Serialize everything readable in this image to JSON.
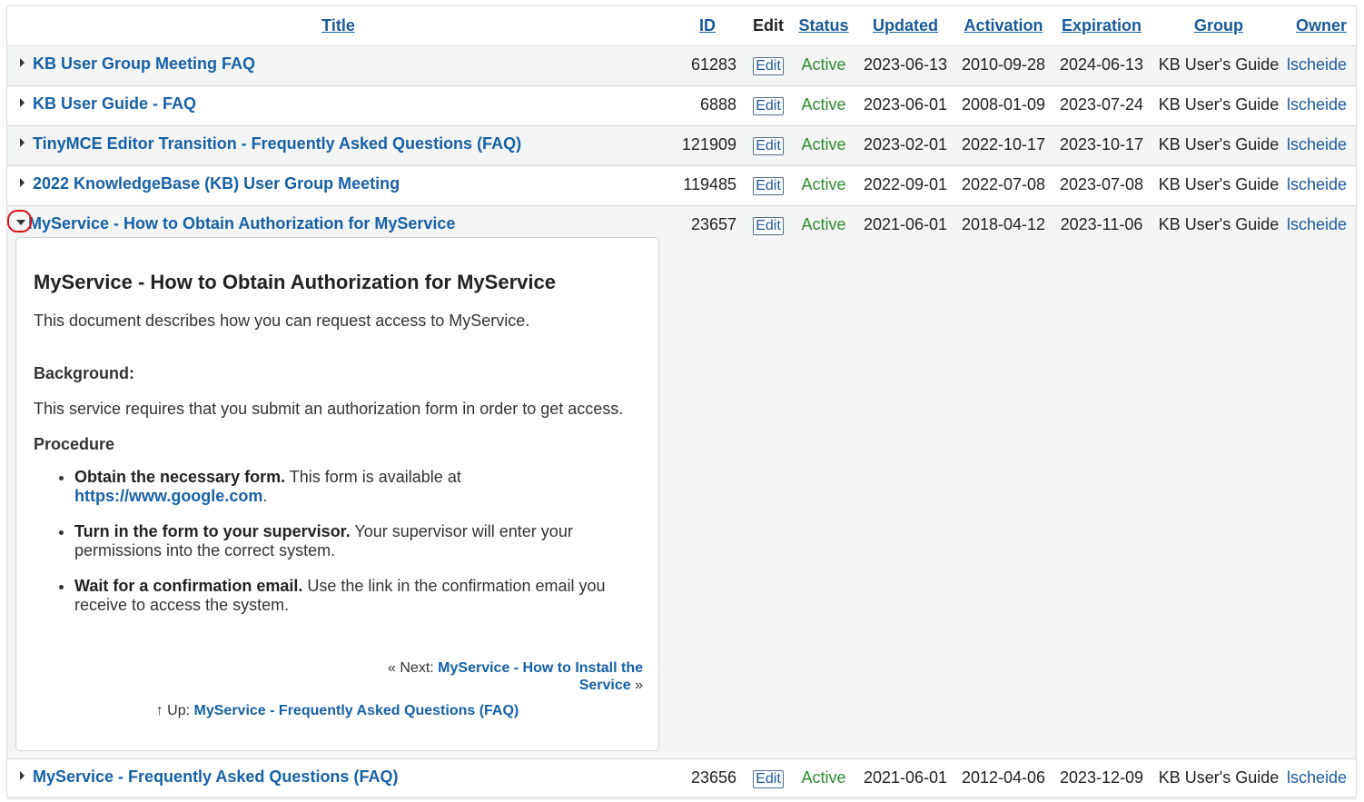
{
  "columns": {
    "title": "Title",
    "id": "ID",
    "edit": "Edit",
    "status": "Status",
    "updated": "Updated",
    "activation": "Activation",
    "expiration": "Expiration",
    "group": "Group",
    "owner": "Owner"
  },
  "icons": {
    "collapsed": "caret-right-icon",
    "expanded": "caret-down-icon"
  },
  "colors": {
    "link": "#1661a6",
    "status_active": "#2e8b2e",
    "highlight_ring": "#d9131b",
    "row_shade": "#f4f5f5"
  },
  "rows": [
    {
      "title": "KB User Group Meeting FAQ",
      "id": "61283",
      "edit": "Edit",
      "status": "Active",
      "updated": "2023-06-13",
      "activation": "2010-09-28",
      "expiration": "2024-06-13",
      "group": "KB User's Guide",
      "owner": "lscheide"
    },
    {
      "title": "KB User Guide - FAQ",
      "id": "6888",
      "edit": "Edit",
      "status": "Active",
      "updated": "2023-06-01",
      "activation": "2008-01-09",
      "expiration": "2023-07-24",
      "group": "KB User's Guide",
      "owner": "lscheide"
    },
    {
      "title": "TinyMCE Editor Transition - Frequently Asked Questions (FAQ)",
      "id": "121909",
      "edit": "Edit",
      "status": "Active",
      "updated": "2023-02-01",
      "activation": "2022-10-17",
      "expiration": "2023-10-17",
      "group": "KB User's Guide",
      "owner": "lscheide"
    },
    {
      "title": "2022 KnowledgeBase (KB) User Group Meeting",
      "id": "119485",
      "edit": "Edit",
      "status": "Active",
      "updated": "2022-09-01",
      "activation": "2022-07-08",
      "expiration": "2023-07-08",
      "group": "KB User's Guide",
      "owner": "lscheide"
    },
    {
      "title": "MyService - How to Obtain Authorization for MyService",
      "id": "23657",
      "edit": "Edit",
      "status": "Active",
      "updated": "2021-06-01",
      "activation": "2018-04-12",
      "expiration": "2023-11-06",
      "group": "KB User's Guide",
      "owner": "lscheide"
    },
    {
      "title": "MyService - Frequently Asked Questions (FAQ)",
      "id": "23656",
      "edit": "Edit",
      "status": "Active",
      "updated": "2021-06-01",
      "activation": "2012-04-06",
      "expiration": "2023-12-09",
      "group": "KB User's Guide",
      "owner": "lscheide"
    }
  ],
  "preview": {
    "heading": "MyService - How to Obtain Authorization for MyService",
    "intro": "This document describes how you can request access to MyService.",
    "background_label": "Background:",
    "requirement": "This service requires that you submit an authorization form in order to get access.",
    "procedure_label": "Procedure",
    "steps": [
      {
        "bold": "Obtain the necessary form.",
        "text": " This form is available at ",
        "link": "https://www.google.com",
        "tail": "."
      },
      {
        "bold": "Turn in the form to your supervisor.",
        "text": " Your supervisor will enter your permissions into the correct system."
      },
      {
        "bold": "Wait for a confirmation email.",
        "text": " Use the link in the confirmation email you receive to access the system."
      }
    ],
    "next_prefix": "« Next: ",
    "next_link": "MyService - How to Install the Service",
    "next_suffix": " »",
    "up_prefix": "↑ Up: ",
    "up_link": "MyService - Frequently Asked Questions (FAQ)"
  }
}
